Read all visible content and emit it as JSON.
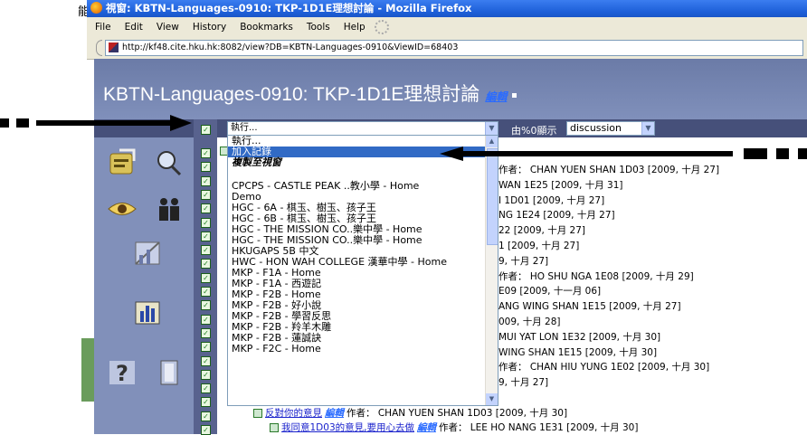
{
  "window": {
    "title": "視窗: KBTN-Languages-0910: TKP-1D1E理想討論 - Mozilla Firefox",
    "left_cut_text": "能"
  },
  "menu": [
    "File",
    "Edit",
    "View",
    "History",
    "Bookmarks",
    "Tools",
    "Help"
  ],
  "url": "http://kf48.cite.hku.hk:8082/view?DB=KBTN-Languages-0910&ViewID=68403",
  "page": {
    "title": "KBTN-Languages-0910: TKP-1D1E理想討論",
    "edit_link": "編輯"
  },
  "toolbar": {
    "action_select_value": "執行...",
    "show_label": "由%0顯示",
    "view_select_value": "discussion"
  },
  "dropdown": {
    "items": [
      {
        "label": "執行...",
        "kind": "normal"
      },
      {
        "label": "加入記錄",
        "kind": "selected"
      },
      {
        "label": "複製至視窗",
        "kind": "group"
      },
      {
        "label": "",
        "kind": "blank"
      },
      {
        "label": "CPCPS - CASTLE PEAK ..教小學 - Home",
        "kind": "normal"
      },
      {
        "label": "Demo",
        "kind": "normal"
      },
      {
        "label": "HGC - 6A - 棋玉、樹玉、孩子王",
        "kind": "normal"
      },
      {
        "label": "HGC - 6B - 棋玉、樹玉、孩子王",
        "kind": "normal"
      },
      {
        "label": "HGC - THE MISSION CO..樂中學 - Home",
        "kind": "normal"
      },
      {
        "label": "HGC - THE MISSION CO..樂中學 - Home",
        "kind": "normal"
      },
      {
        "label": "HKUGAPS 5B 中文",
        "kind": "normal"
      },
      {
        "label": "HWC - HON WAH COLLEGE 漢華中學 - Home",
        "kind": "normal"
      },
      {
        "label": "MKP - F1A - Home",
        "kind": "normal"
      },
      {
        "label": "MKP - F1A - 西遊記",
        "kind": "normal"
      },
      {
        "label": "MKP - F2B - Home",
        "kind": "normal"
      },
      {
        "label": "MKP - F2B - 好小說",
        "kind": "normal"
      },
      {
        "label": "MKP - F2B - 學習反思",
        "kind": "normal"
      },
      {
        "label": "MKP - F2B - 羚羊木雕",
        "kind": "normal"
      },
      {
        "label": "MKP - F2B - 蓮誠訣",
        "kind": "normal"
      },
      {
        "label": "MKP - F2C - Home",
        "kind": "normal"
      }
    ]
  },
  "entries": [
    {
      "text": "作者： CHAN YUEN SHAN 1D03 [2009, 十月 27]"
    },
    {
      "text": "WAN 1E25 [2009, 十月 31]"
    },
    {
      "text": "I 1D01 [2009, 十月 27]"
    },
    {
      "text": "NG 1E24 [2009, 十月 27]"
    },
    {
      "text": "22 [2009, 十月 27]"
    },
    {
      "text": "1 [2009, 十月 27]"
    },
    {
      "text": "9, 十月 27]"
    },
    {
      "text": "作者： HO SHU NGA 1E08 [2009, 十月 29]"
    },
    {
      "text": "E09 [2009, 十一月 06]"
    },
    {
      "text": "ANG WING SHAN 1E15 [2009, 十月 27]"
    },
    {
      "text": "009, 十月 28]"
    },
    {
      "text": "MUI YAT LON 1E32 [2009, 十月 30]"
    },
    {
      "text": "WING SHAN 1E15 [2009, 十月 30]"
    },
    {
      "text": "作者： CHAN HIU YUNG 1E02 [2009, 十月 30]"
    },
    {
      "text": "9, 十月 27]"
    }
  ],
  "bottom_entries": [
    {
      "link": "反對你的意見",
      "edit": "編輯",
      "rest": "作者： CHAN YUEN SHAN 1D03 [2009, 十月 30]"
    },
    {
      "link": "我同意1D03的意見,要用心去做",
      "edit": "編輯",
      "rest": "作者： LEE HO NANG 1E31 [2009, 十月 30]"
    }
  ],
  "colors": {
    "header_bg": "#7181ae",
    "action_bar": "#46507a",
    "left_panel": "#8190ba",
    "selected": "#316ac5",
    "link": "#1a22cc"
  },
  "icons": [
    "notes-icon",
    "search-icon",
    "eye-icon",
    "people-icon",
    "chart-crossed-icon",
    "bar-chart-icon",
    "help-icon",
    "door-icon"
  ]
}
